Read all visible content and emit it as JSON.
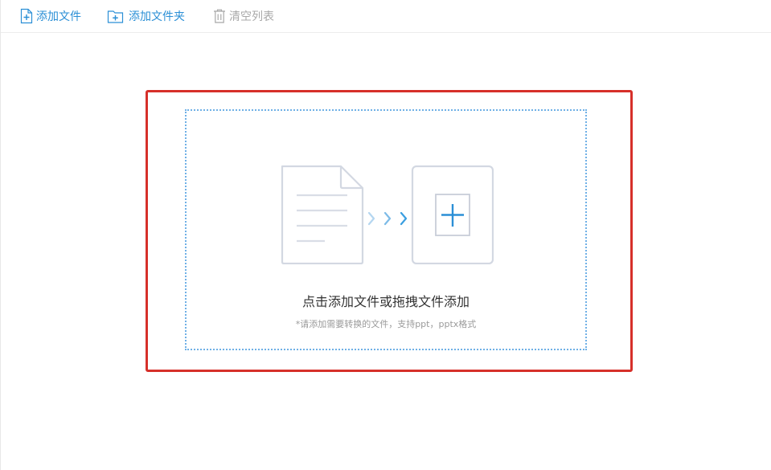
{
  "toolbar": {
    "add_file": {
      "label": "添加文件",
      "icon": "add-file-icon"
    },
    "add_folder": {
      "label": "添加文件夹",
      "icon": "add-folder-icon"
    },
    "clear_list": {
      "label": "清空列表",
      "icon": "trash-icon",
      "state": "disabled"
    }
  },
  "drop_zone": {
    "title": "点击添加文件或拖拽文件添加",
    "hint": "*请添加需要转换的文件，支持ppt，pptx格式",
    "icons": [
      "document-icon",
      "arrows-right-icon",
      "add-box-icon"
    ]
  },
  "colors": {
    "accent": "#2b8fd6",
    "disabled": "#a8a8a8",
    "highlight_border": "#d6302a",
    "dotted_border": "#6fb0e6"
  }
}
